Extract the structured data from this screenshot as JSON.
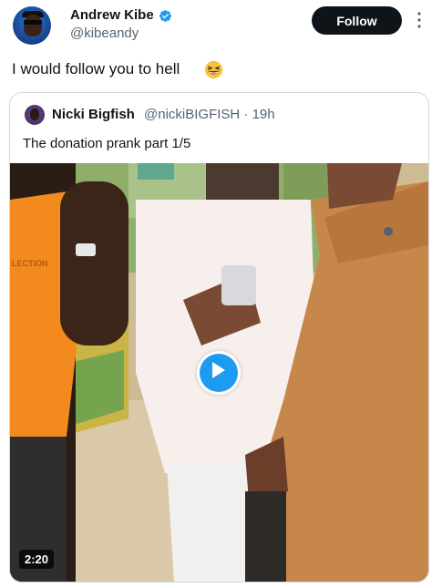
{
  "author": {
    "name": "Andrew Kibe",
    "handle": "@kibeandy",
    "verified": true,
    "avatar_icon": "profile-photo"
  },
  "follow_button": {
    "label": "Follow"
  },
  "tweet": {
    "text": "I would follow you to hell",
    "emoji": "grinning-squinting-face"
  },
  "quoted": {
    "name": "Nicki Bigfish",
    "handle_time": "@nickiBIGFISH · 19h",
    "text": "The donation prank part 1/5",
    "video": {
      "duration": "2:20",
      "shirt_text": "LECTION"
    }
  },
  "colors": {
    "follow_bg": "#0f1419",
    "verified": "#1d9bf0",
    "play_button": "#1d9bf0",
    "secondary_text": "#536471",
    "card_border": "#cfd9de"
  }
}
